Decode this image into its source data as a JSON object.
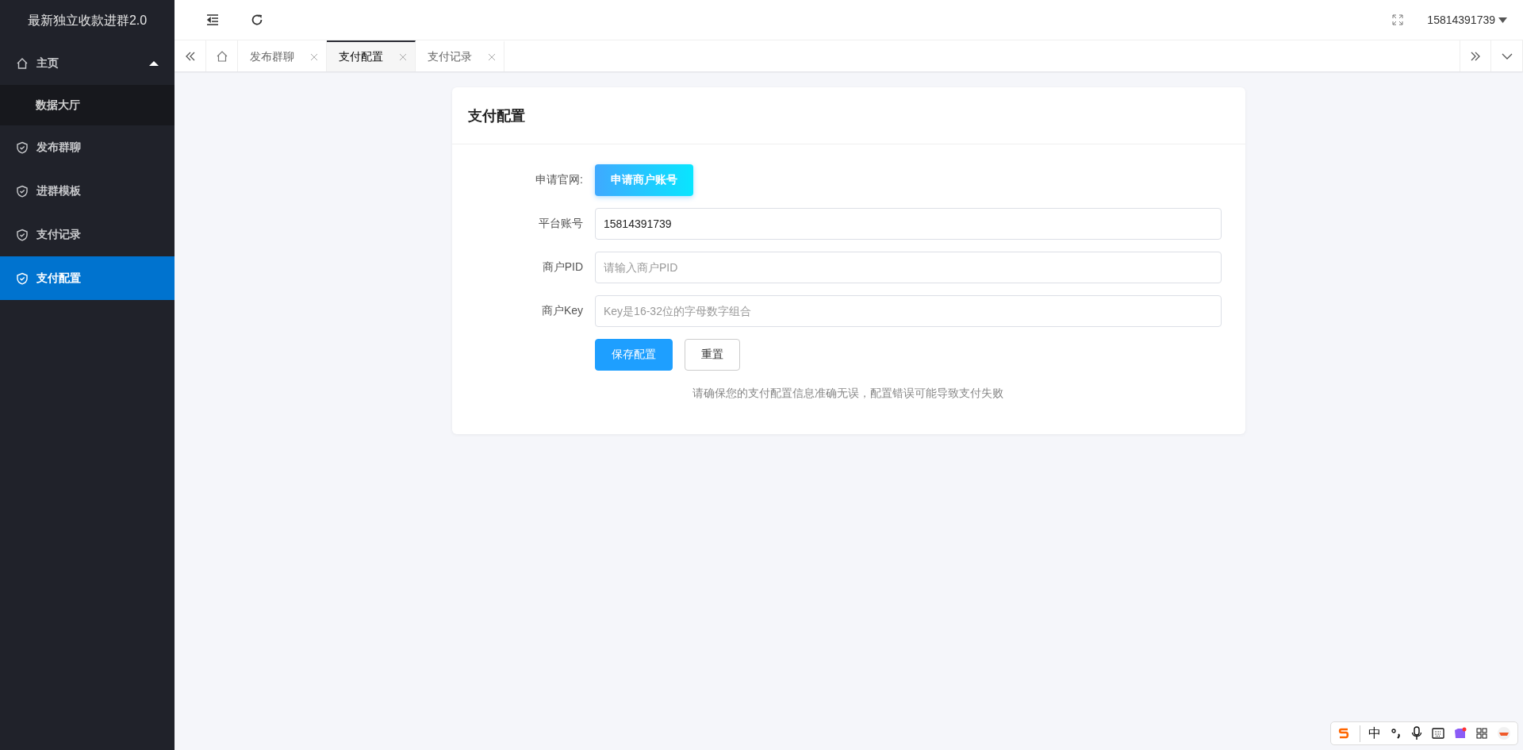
{
  "sidebar": {
    "title": "最新独立收款进群2.0",
    "items": [
      {
        "label": "主页",
        "kind": "home",
        "expanded": true,
        "selected": false,
        "children": [
          {
            "label": "数据大厅",
            "selected": false
          }
        ]
      },
      {
        "label": "发布群聊",
        "kind": "page",
        "selected": false
      },
      {
        "label": "进群模板",
        "kind": "page",
        "selected": false
      },
      {
        "label": "支付记录",
        "kind": "page",
        "selected": false
      },
      {
        "label": "支付配置",
        "kind": "page",
        "selected": true
      }
    ]
  },
  "topbar": {
    "user": "15814391739"
  },
  "tabs": [
    {
      "label": "发布群聊",
      "selected": false
    },
    {
      "label": "支付配置",
      "selected": true
    },
    {
      "label": "支付记录",
      "selected": false
    }
  ],
  "card": {
    "title": "支付配置",
    "apply": {
      "label": "申请官网:",
      "button": "申请商户账号"
    },
    "fields": [
      {
        "label": "平台账号",
        "value": "15814391739"
      },
      {
        "label": "商户PID",
        "placeholder": "请输入商户PID"
      },
      {
        "label": "商户Key",
        "placeholder": "Key是16-32位的字母数字组合"
      }
    ],
    "buttons": [
      {
        "label": "保存配置",
        "kind": "primary"
      },
      {
        "label": "重置",
        "kind": "default"
      }
    ],
    "note": "请确保您的支付配置信息准确无误，配置错误可能导致支付失败"
  },
  "ime": {
    "mode": "中"
  }
}
